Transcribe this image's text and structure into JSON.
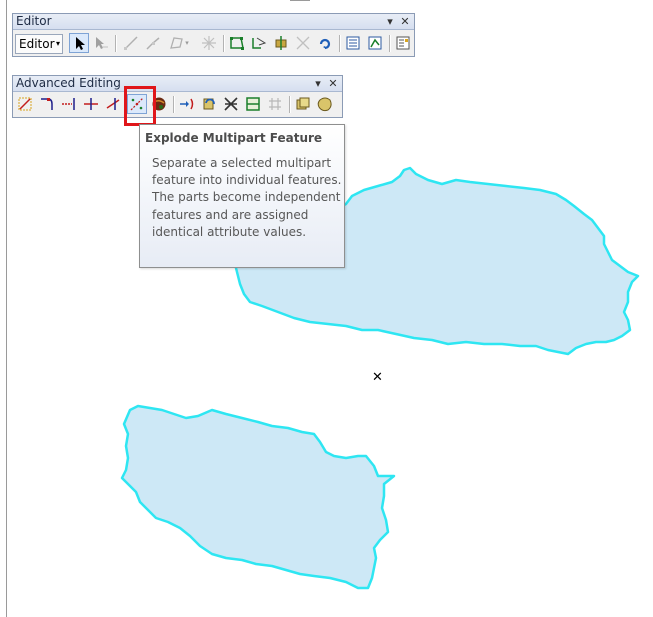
{
  "editor_toolbar": {
    "title": "Editor",
    "dropdown_label": "Editor",
    "dropdown_arrow": "▾",
    "minimize_glyph": "▾",
    "close_glyph": "✕"
  },
  "advanced_toolbar": {
    "title": "Advanced Editing",
    "minimize_glyph": "▾",
    "close_glyph": "✕"
  },
  "tooltip": {
    "title": "Explode Multipart Feature",
    "body": "Separate a selected multipart feature into individual features. The parts become independent features and are assigned identical attribute values."
  },
  "map": {
    "cursor_glyph": "✕",
    "polygon_fill": "#cde8f6",
    "polygon_stroke": "#2ee6f2"
  },
  "colors": {
    "highlight": "#e0161a",
    "selected_button": "#dbe9fb"
  }
}
